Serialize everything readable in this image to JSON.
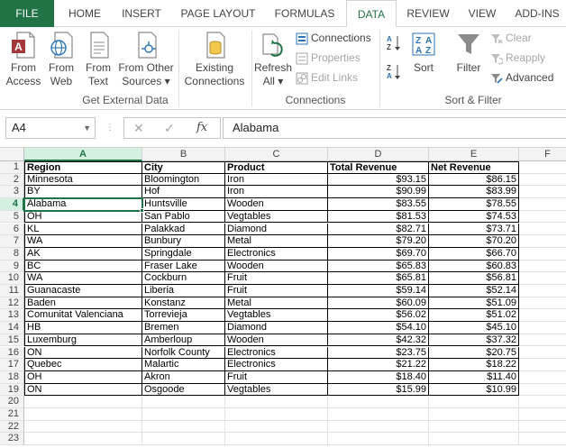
{
  "ribbon_tabs": [
    "FILE",
    "HOME",
    "INSERT",
    "PAGE LAYOUT",
    "FORMULAS",
    "DATA",
    "REVIEW",
    "VIEW",
    "ADD-INS"
  ],
  "active_tab": "DATA",
  "get_external_data": {
    "label": "Get External Data",
    "buttons": [
      {
        "line1": "From",
        "line2": "Access"
      },
      {
        "line1": "From",
        "line2": "Web"
      },
      {
        "line1": "From",
        "line2": "Text"
      },
      {
        "line1": "From Other",
        "line2": "Sources ▾"
      }
    ],
    "existing": {
      "line1": "Existing",
      "line2": "Connections"
    }
  },
  "connections": {
    "label": "Connections",
    "refresh": {
      "line1": "Refresh",
      "line2": "All ▾"
    },
    "connections_btn": "Connections",
    "properties_btn": "Properties",
    "edit_links_btn": "Edit Links"
  },
  "sort_filter": {
    "label": "Sort & Filter",
    "sort": "Sort",
    "filter": "Filter",
    "clear": "Clear",
    "reapply": "Reapply",
    "advanced": "Advanced"
  },
  "formula_bar": {
    "name_box": "A4",
    "value": "Alabama",
    "fx": "fx"
  },
  "columns": [
    "A",
    "B",
    "C",
    "D",
    "E",
    "F"
  ],
  "selected_column": "A",
  "selected_row": 4,
  "row_numbers": [
    1,
    2,
    3,
    4,
    5,
    6,
    7,
    8,
    9,
    10,
    11,
    12,
    13,
    14,
    15,
    16,
    17,
    18,
    19,
    20,
    21,
    22,
    23
  ],
  "table": {
    "headers": [
      "Region",
      "City",
      "Product",
      "Total Revenue",
      "Net Revenue"
    ],
    "rows": [
      [
        "Minnesota",
        "Bloomington",
        "Iron",
        "$93.15",
        "$86.15"
      ],
      [
        "BY",
        "Hof",
        "Iron",
        "$90.99",
        "$83.99"
      ],
      [
        "Alabama",
        "Huntsville",
        "Wooden",
        "$83.55",
        "$78.55"
      ],
      [
        "OH",
        "San Pablo",
        "Vegtables",
        "$81.53",
        "$74.53"
      ],
      [
        "KL",
        "Palakkad",
        "Diamond",
        "$82.71",
        "$73.71"
      ],
      [
        "WA",
        "Bunbury",
        "Metal",
        "$79.20",
        "$70.20"
      ],
      [
        "AK",
        "Springdale",
        "Electronics",
        "$69.70",
        "$66.70"
      ],
      [
        "BC",
        "Fraser Lake",
        "Wooden",
        "$65.83",
        "$60.83"
      ],
      [
        "WA",
        "Cockburn",
        "Fruit",
        "$65.81",
        "$56.81"
      ],
      [
        "Guanacaste",
        "Liberia",
        "Fruit",
        "$59.14",
        "$52.14"
      ],
      [
        "Baden",
        "Konstanz",
        "Metal",
        "$60.09",
        "$51.09"
      ],
      [
        "Comunitat Valenciana",
        "Torrevieja",
        "Vegtables",
        "$56.02",
        "$51.02"
      ],
      [
        "HB",
        "Bremen",
        "Diamond",
        "$54.10",
        "$45.10"
      ],
      [
        "Luxemburg",
        "Amberloup",
        "Wooden",
        "$42.32",
        "$37.32"
      ],
      [
        "ON",
        "Norfolk County",
        "Electronics",
        "$23.75",
        "$20.75"
      ],
      [
        "Quebec",
        "Malartic",
        "Electronics",
        "$21.22",
        "$18.22"
      ],
      [
        "OH",
        "Akron",
        "Fruit",
        "$18.40",
        "$11.40"
      ],
      [
        "ON",
        "Osgoode",
        "Vegtables",
        "$15.99",
        "$10.99"
      ]
    ]
  },
  "colors": {
    "excel_green": "#217346",
    "header_bg": "#f3f3f3",
    "selection_bg": "#d3f0e0"
  }
}
